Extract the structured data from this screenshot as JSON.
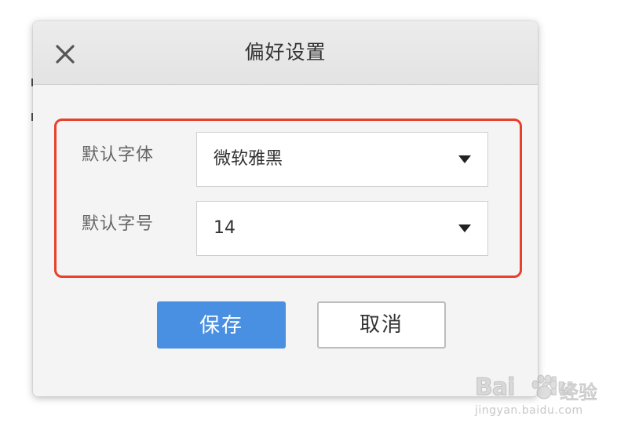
{
  "dialog": {
    "title": "偏好设置",
    "close_icon": "close-icon"
  },
  "settings": {
    "font_label": "默认字体",
    "font_value": "微软雅黑",
    "size_label": "默认字号",
    "size_value": "14",
    "dropdown_icon": "caret-down-icon",
    "highlight_color": "#e8402a"
  },
  "buttons": {
    "save_label": "保存",
    "cancel_label": "取消",
    "save_color": "#4a90e2"
  },
  "watermark": {
    "brand": "Bai",
    "brand_suffix": "du",
    "product": "经验",
    "url": "jingyan.baidu.com"
  }
}
